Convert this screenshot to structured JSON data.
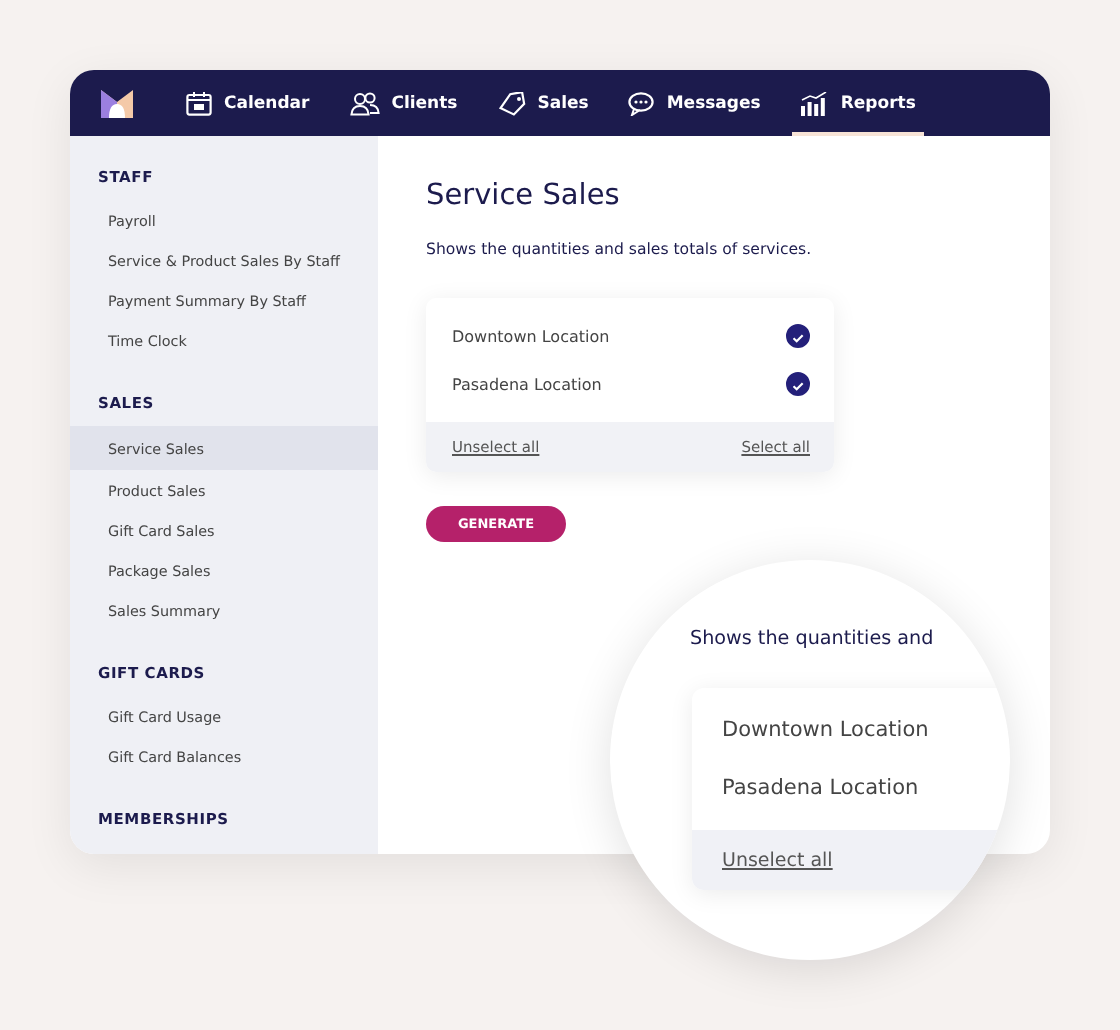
{
  "nav": {
    "items": [
      {
        "label": "Calendar",
        "selected": false
      },
      {
        "label": "Clients",
        "selected": false
      },
      {
        "label": "Sales",
        "selected": false
      },
      {
        "label": "Messages",
        "selected": false
      },
      {
        "label": "Reports",
        "selected": true
      }
    ]
  },
  "sidebar": {
    "sections": [
      {
        "heading": "STAFF",
        "items": [
          {
            "label": "Payroll",
            "selected": false
          },
          {
            "label": "Service & Product Sales By Staff",
            "selected": false
          },
          {
            "label": "Payment Summary By Staff",
            "selected": false
          },
          {
            "label": "Time Clock",
            "selected": false
          }
        ]
      },
      {
        "heading": "SALES",
        "items": [
          {
            "label": "Service Sales",
            "selected": true
          },
          {
            "label": "Product Sales",
            "selected": false
          },
          {
            "label": "Gift Card Sales",
            "selected": false
          },
          {
            "label": "Package Sales",
            "selected": false
          },
          {
            "label": "Sales Summary",
            "selected": false
          }
        ]
      },
      {
        "heading": "GIFT CARDS",
        "items": [
          {
            "label": "Gift Card Usage",
            "selected": false
          },
          {
            "label": "Gift Card Balances",
            "selected": false
          }
        ]
      },
      {
        "heading": "MEMBERSHIPS"
      }
    ]
  },
  "main": {
    "title": "Service Sales",
    "description": "Shows the quantities and sales totals of services.",
    "locations": [
      {
        "label": "Downtown Location",
        "checked": true
      },
      {
        "label": "Pasadena Location",
        "checked": true
      }
    ],
    "unselect_all": "Unselect all",
    "select_all": "Select all",
    "generate_button": "GENERATE"
  },
  "magnifier": {
    "description": "Shows the quantities and",
    "locations": [
      "Downtown Location",
      "Pasadena Location"
    ],
    "unselect_all": "Unselect all"
  }
}
